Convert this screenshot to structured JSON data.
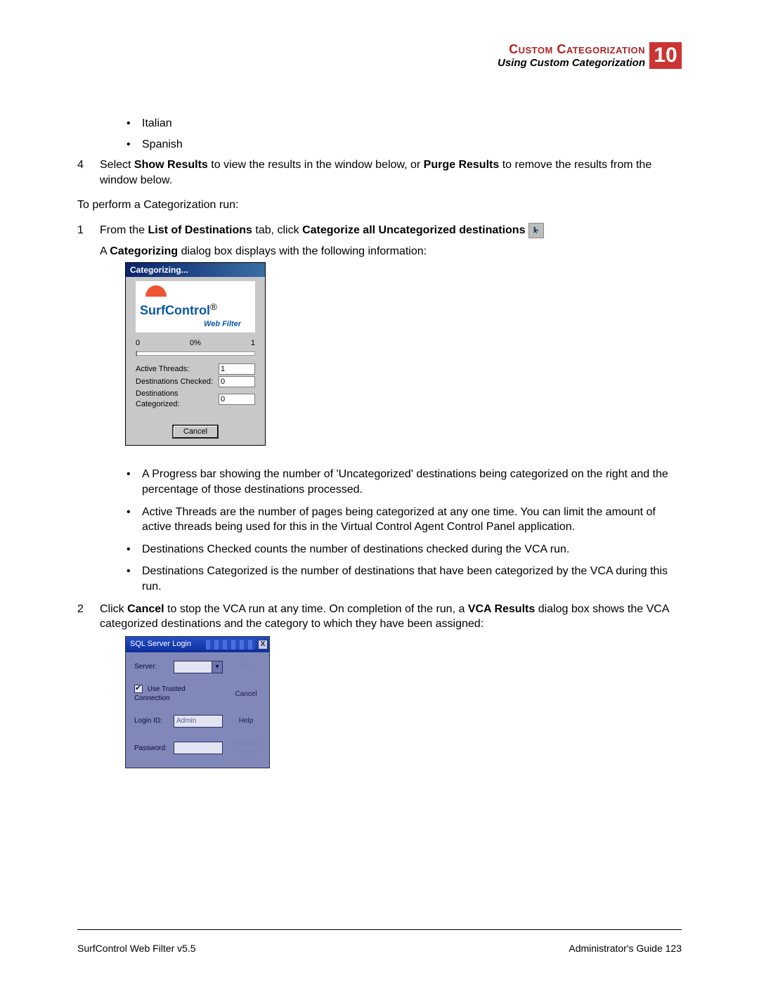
{
  "header": {
    "line1": "Custom Categorization",
    "line2": "Using Custom Categorization",
    "chapter": "10"
  },
  "intro_bullets": [
    "Italian",
    "Spanish"
  ],
  "step4": {
    "num": "4",
    "pre": "Select ",
    "b1": "Show Results",
    "mid": " to view the results in the window below, or ",
    "b2": "Purge Results",
    "post": " to remove the results from the window below."
  },
  "perform_line": "To perform a Categorization run:",
  "step1a": {
    "num": "1",
    "pre": "From the ",
    "b1": "List of Destinations",
    "mid": " tab, click ",
    "b2": "Categorize all Uncategorized destinations"
  },
  "step1b": {
    "pre": "A ",
    "b": "Categorizing",
    "post": " dialog box displays with the following information:"
  },
  "dlg_cat": {
    "title": "Categorizing...",
    "logo_text": "SurfControl",
    "logo_tm": "®",
    "logo_sub": "Web Filter",
    "pct_left": "0",
    "pct_mid": "0%",
    "pct_right": "1",
    "rows": [
      {
        "label": "Active Threads:",
        "value": "1"
      },
      {
        "label": "Destinations Checked:",
        "value": "0"
      },
      {
        "label": "Destinations Categorized:",
        "value": "0"
      }
    ],
    "cancel": "Cancel"
  },
  "sub_bullets": [
    "A Progress bar showing the number of 'Uncategorized' destinations being categorized on the right and the percentage of those destinations processed.",
    "Active Threads are the number of pages being categorized at any one time. You can limit the amount of active threads being used for this in the Virtual Control Agent Control Panel application.",
    "Destinations Checked counts the number of destinations checked during the VCA run.",
    "Destinations Categorized is the number of destinations that have been categorized by the VCA during this run."
  ],
  "step2": {
    "num": "2",
    "pre": "Click ",
    "b1": "Cancel",
    "mid": " to stop the VCA run at any time. On completion of the run, a ",
    "b2": "VCA Results",
    "post": " dialog box shows the VCA categorized destinations and the category to which they have been assigned:"
  },
  "dlg_sql": {
    "title": "SQL Server Login",
    "server_label": "Server:",
    "server_value": "",
    "ok": "OK",
    "use_trusted": "Use Trusted Connection",
    "cancel": "Cancel",
    "login_label": "Login ID:",
    "login_value": "Admin",
    "help": "Help",
    "password_label": "Password:",
    "password_value": "",
    "options": "Options >>"
  },
  "footer": {
    "left": "SurfControl Web Filter v5.5",
    "right": "Administrator's Guide   123"
  }
}
